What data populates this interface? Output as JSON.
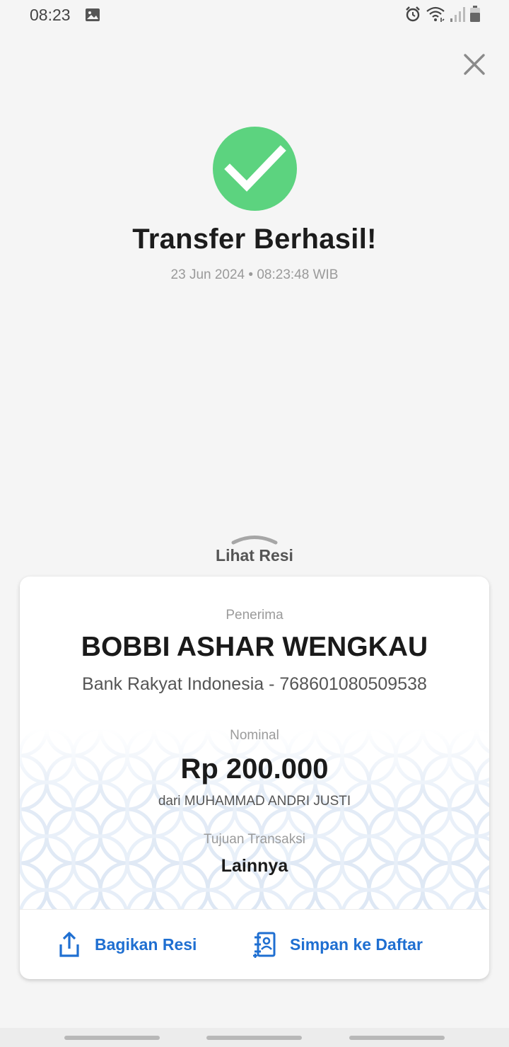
{
  "status_bar": {
    "time": "08:23",
    "icons": [
      "gallery-icon",
      "alarm-icon",
      "wifi-icon",
      "signal-icon",
      "battery-icon"
    ]
  },
  "close_icon": "close-icon",
  "success": {
    "icon": "checkmark-icon",
    "title": "Transfer Berhasil!",
    "datetime": "23 Jun 2024 • 08:23:48 WIB"
  },
  "receipt": {
    "toggle_label": "Lihat Resi",
    "recipient_label": "Penerima",
    "recipient_name": "BOBBI ASHAR WENGKAU",
    "recipient_bank": "Bank Rakyat Indonesia - 768601080509538",
    "amount_label": "Nominal",
    "amount": "Rp 200.000",
    "sender": "dari MUHAMMAD ANDRI JUSTI",
    "purpose_label": "Tujuan Transaksi",
    "purpose": "Lainnya",
    "actions": {
      "share_label": "Bagikan Resi",
      "save_label": "Simpan ke Daftar"
    }
  },
  "colors": {
    "success_green": "#5cd37f",
    "action_blue": "#1f6fd1",
    "pattern_blue": "#e3ecf7"
  }
}
